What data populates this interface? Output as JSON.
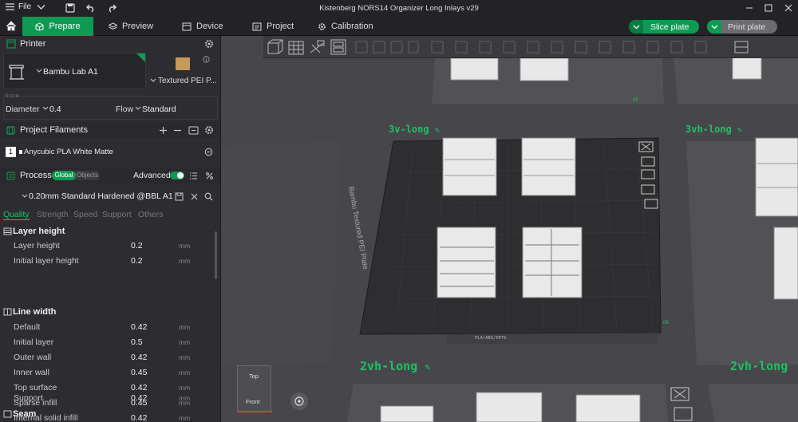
{
  "titlebar": {
    "menu_label": "File",
    "title": "Kistenberg NORS14 Organizer Long Inlays v29"
  },
  "tabs": [
    {
      "label": "Prepare"
    },
    {
      "label": "Preview"
    },
    {
      "label": "Device"
    },
    {
      "label": "Project"
    },
    {
      "label": "Calibration"
    }
  ],
  "actions": {
    "slice_label": "Slice plate",
    "print_label": "Print plate"
  },
  "printer": {
    "section_title": "Printer",
    "name": "Bambu Lab A1",
    "plate": "Textured PEI P...",
    "nozzle_caption": "Nozzle",
    "diameter_label": "Diameter",
    "diameter_value": "0.4",
    "flow_label": "Flow",
    "flow_value": "Standard"
  },
  "filaments": {
    "section_title": "Project Filaments",
    "items": [
      {
        "index": "1",
        "name": "Anycubic PLA White Matte",
        "color": "#ffffff"
      }
    ]
  },
  "process": {
    "section_title": "Process",
    "toggle_global": "Global",
    "toggle_objects": "Objects",
    "advanced_label": "Advanced",
    "preset": "0.20mm Standard Hardened @BBL A1",
    "subtabs": [
      "Quality",
      "Strength",
      "Speed",
      "Support",
      "Others"
    ],
    "groups": [
      {
        "title": "Layer height",
        "rows": [
          {
            "label": "Layer height",
            "value": "0.2",
            "unit": "mm"
          },
          {
            "label": "Initial layer height",
            "value": "0.2",
            "unit": "mm"
          }
        ]
      },
      {
        "title": "Line width",
        "rows": [
          {
            "label": "Default",
            "value": "0.42",
            "unit": "mm"
          },
          {
            "label": "Initial layer",
            "value": "0.5",
            "unit": "mm"
          },
          {
            "label": "Outer wall",
            "value": "0.42",
            "unit": "mm"
          },
          {
            "label": "Inner wall",
            "value": "0.45",
            "unit": "mm"
          },
          {
            "label": "Top surface",
            "value": "0.42",
            "unit": "mm"
          },
          {
            "label": "Sparse infill",
            "value": "0.45",
            "unit": "mm"
          },
          {
            "label": "Internal solid infill",
            "value": "0.42",
            "unit": "mm"
          },
          {
            "label": "Support",
            "value": "0.42",
            "unit": "mm"
          }
        ]
      },
      {
        "title": "Seam",
        "rows": []
      }
    ]
  },
  "viewport": {
    "plate_labels": [
      "3v-long",
      "3vh-long",
      "2vh-long",
      "2vh-long"
    ],
    "plate_numbers": [
      "05",
      "09"
    ],
    "bed_text": "Bambu Textured PEI Plate",
    "bed_strip_text": "PLA/ABS/PETG",
    "nav_cube_top": "Top",
    "nav_cube_front": "Front",
    "accent_color": "#1fc063"
  }
}
